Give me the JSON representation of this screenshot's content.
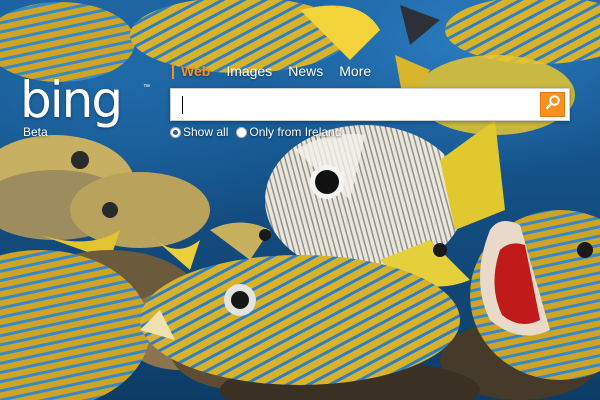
{
  "logo": {
    "text": "bing",
    "tm": "™",
    "beta_label": "Beta"
  },
  "scope_nav": {
    "items": [
      {
        "label": "Web",
        "active": true
      },
      {
        "label": "Images",
        "active": false
      },
      {
        "label": "News",
        "active": false
      },
      {
        "label": "More",
        "active": false
      }
    ],
    "accent_color": "#f7901e"
  },
  "search": {
    "value": "",
    "button_icon": "search-icon",
    "button_color": "#f7901e"
  },
  "filters": {
    "options": [
      {
        "label": "Show all",
        "checked": true
      },
      {
        "label": "Only from Ireland",
        "checked": false
      }
    ]
  },
  "background": {
    "subject": "underwater coral reef with tropical fish"
  }
}
